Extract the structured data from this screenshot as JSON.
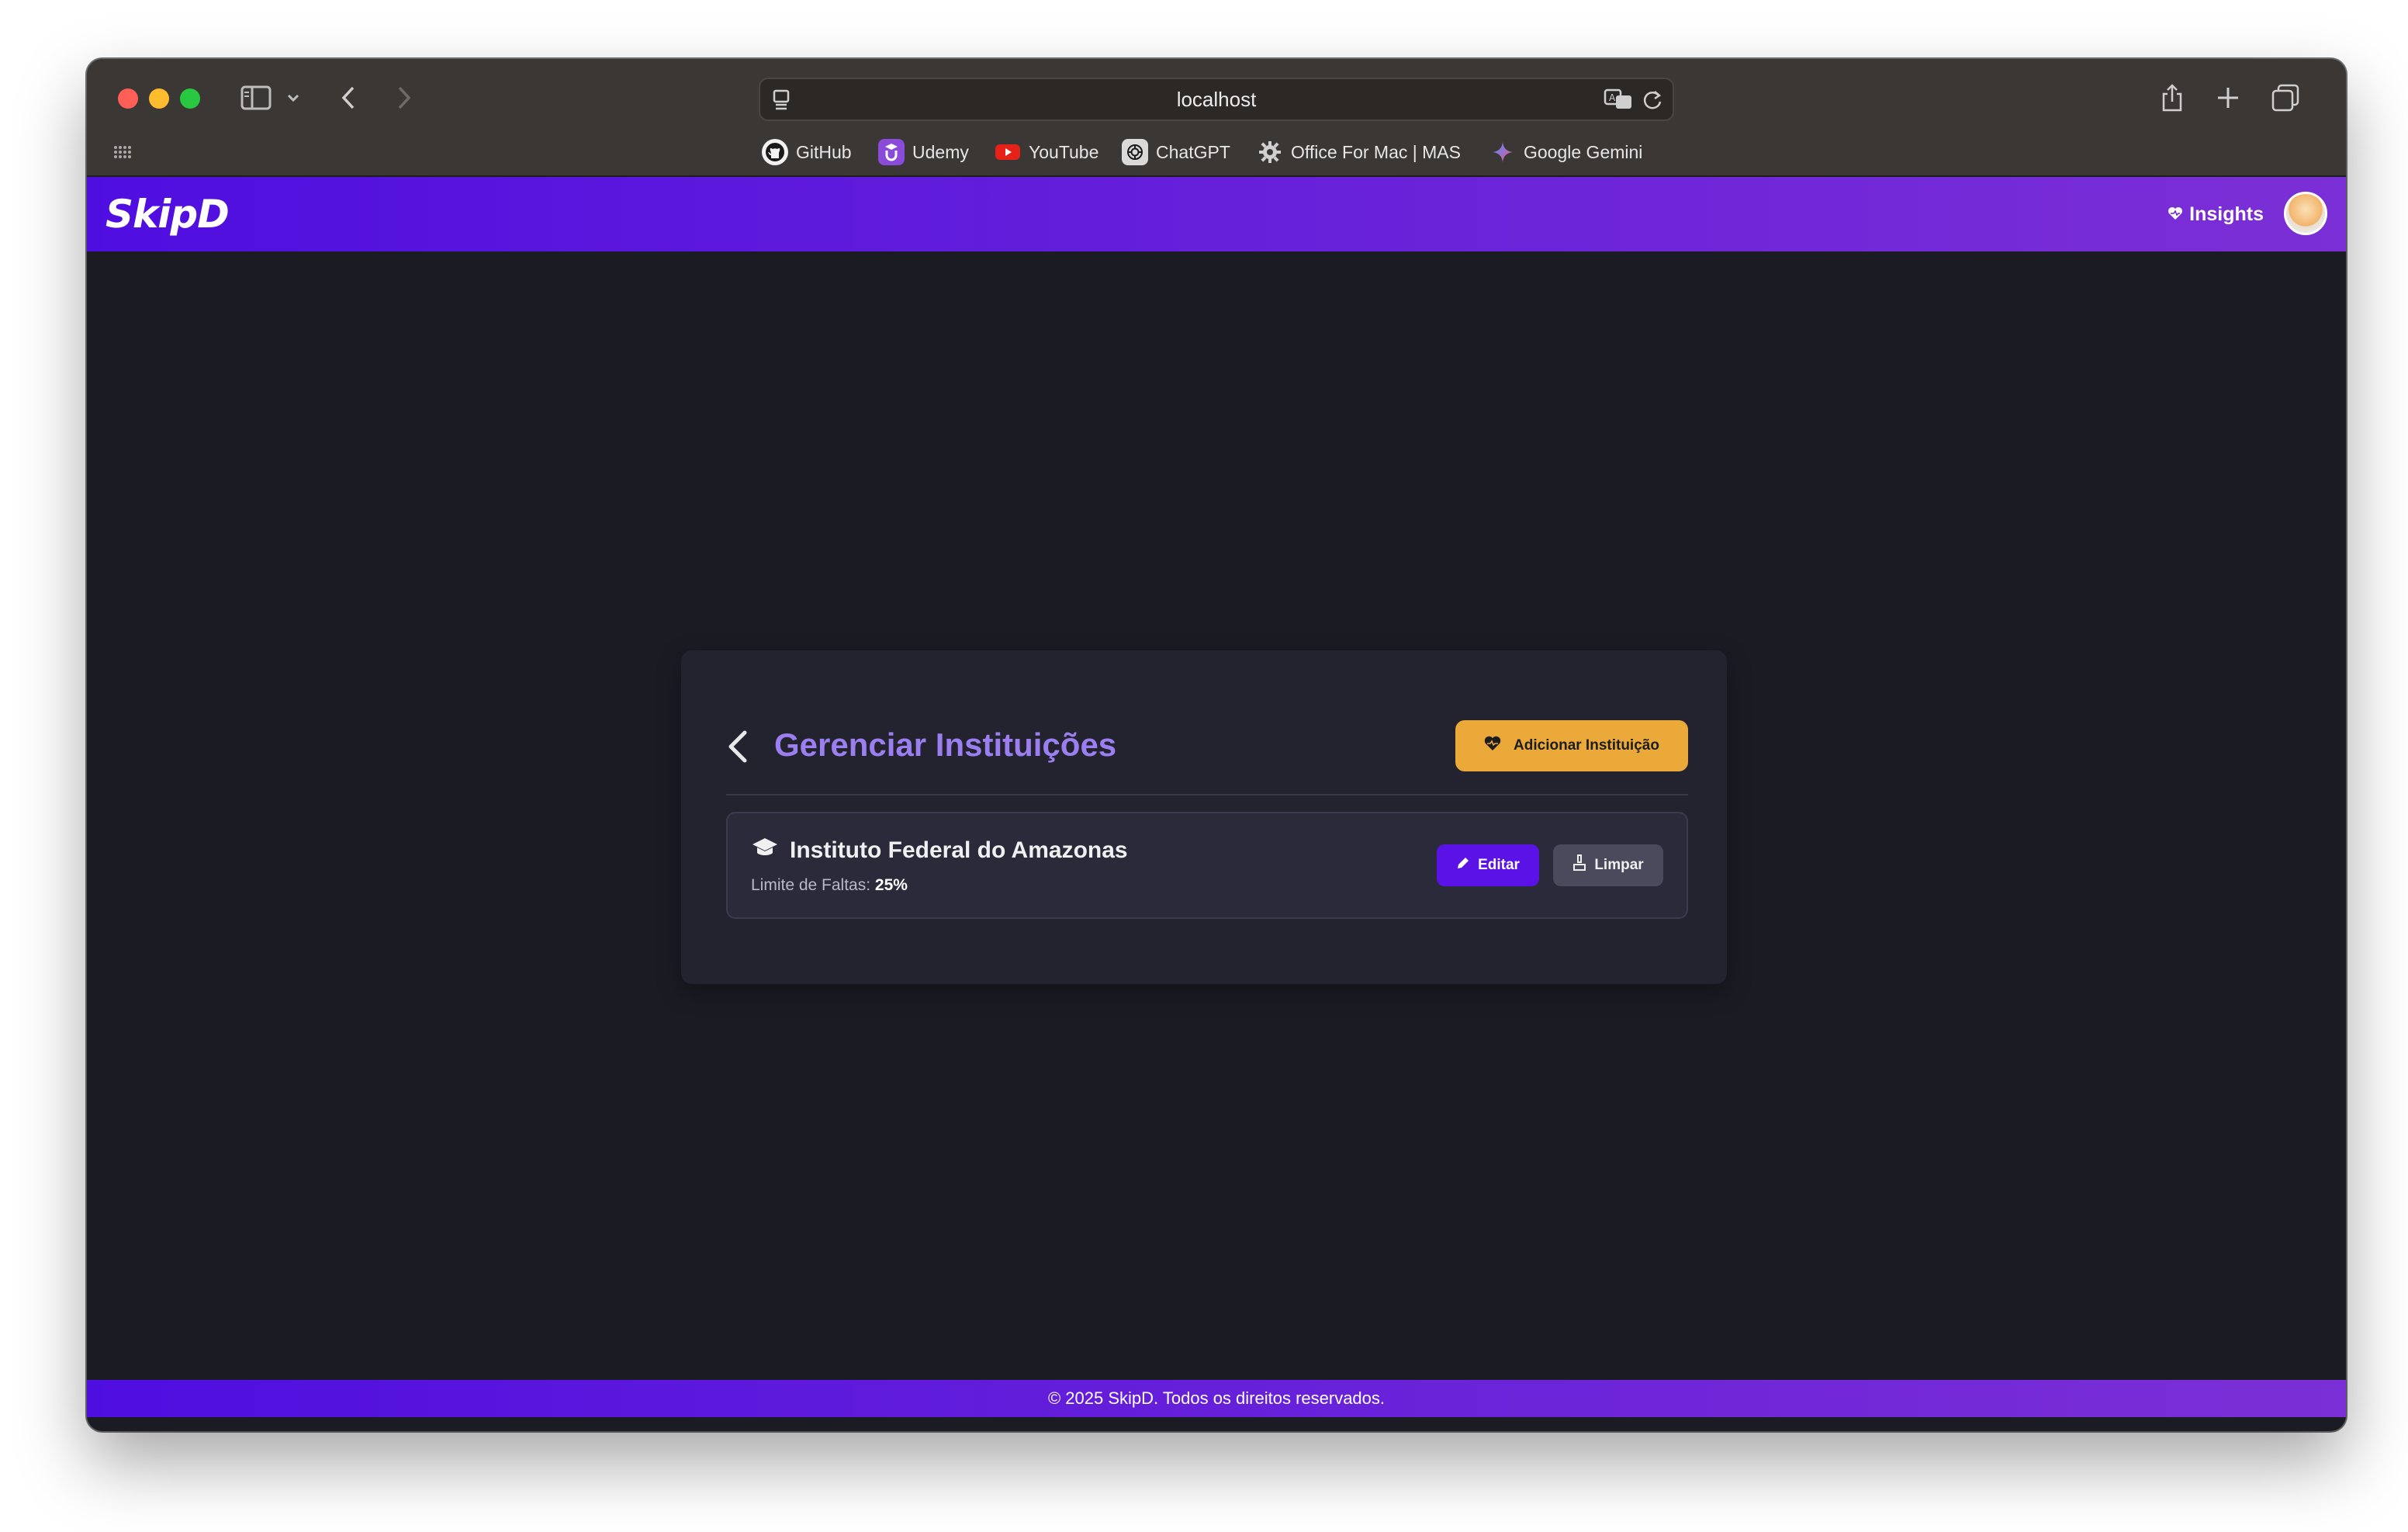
{
  "browser": {
    "url": "localhost",
    "bookmarks": [
      {
        "label": "GitHub",
        "icon": "github-icon"
      },
      {
        "label": "Udemy",
        "icon": "udemy-icon"
      },
      {
        "label": "YouTube",
        "icon": "youtube-icon"
      },
      {
        "label": "ChatGPT",
        "icon": "chatgpt-icon"
      },
      {
        "label": "Office For Mac | MAS",
        "icon": "gear-icon"
      },
      {
        "label": "Google Gemini",
        "icon": "gemini-icon"
      }
    ]
  },
  "header": {
    "logo": "SkipD",
    "insights_label": "Insights",
    "insights_icon": "heart-icon",
    "avatar_icon": "user-avatar"
  },
  "page": {
    "title": "Gerenciar Instituições",
    "add_button_label": "Adicionar Instituição",
    "add_button_icon": "heart-icon",
    "institutions": [
      {
        "name": "Instituto Federal do Amazonas",
        "icon": "graduation-cap-icon",
        "limit_label": "Limite de Faltas:",
        "limit_value": "25%",
        "edit_label": "Editar",
        "clear_label": "Limpar"
      }
    ]
  },
  "footer": {
    "text": "© 2025 SkipD. Todos os direitos reservados."
  },
  "colors": {
    "brand_gradient_start": "#4f0ee0",
    "brand_gradient_end": "#7b2fd6",
    "title_purple": "#9b7ff0",
    "accent_orange": "#eba93a",
    "background": "#1b1b24",
    "card": "#23222f"
  }
}
